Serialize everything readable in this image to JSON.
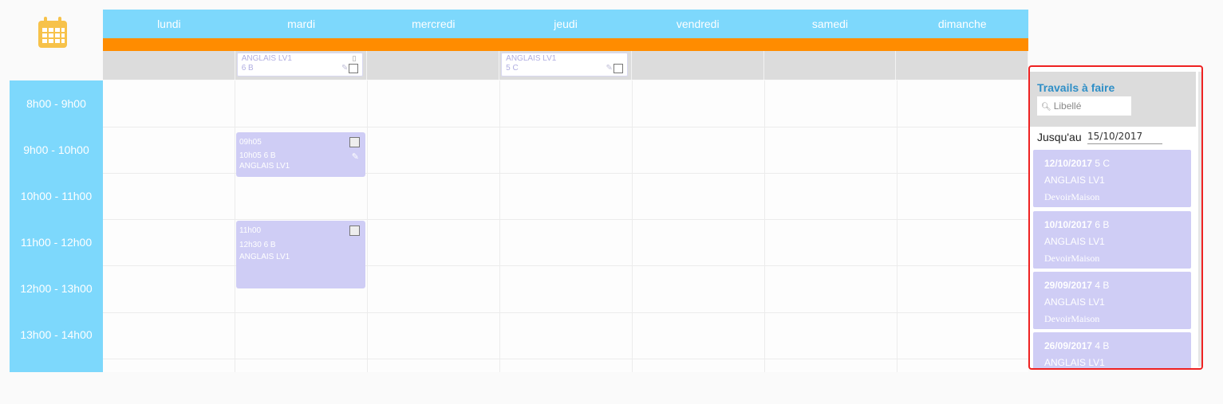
{
  "days": [
    "lundi",
    "mardi",
    "mercredi",
    "jeudi",
    "vendredi",
    "samedi",
    "dimanche"
  ],
  "allday": {
    "mardi_card": {
      "subject": "ANGLAIS LV1",
      "class": "6 B"
    },
    "jeudi_card": {
      "subject": "ANGLAIS LV1",
      "class": "5 C"
    }
  },
  "hours": [
    "8h00 - 9h00",
    "9h00 - 10h00",
    "10h00 - 11h00",
    "11h00 - 12h00",
    "12h00 - 13h00",
    "13h00 - 14h00",
    ""
  ],
  "events": [
    {
      "start": "09h05",
      "end_class": "10h05  6 B",
      "subject": "ANGLAIS LV1"
    },
    {
      "start": "11h00",
      "end_class": "12h30  6 B",
      "subject": "ANGLAIS LV1"
    }
  ],
  "panel": {
    "title": "Travails à faire",
    "search_placeholder": "Libellé",
    "until_label": "Jusqu'au",
    "until_date": "15/10/2017",
    "items": [
      {
        "date": "12/10/2017",
        "class": " 5 C",
        "subject": "ANGLAIS LV1",
        "kind": "DevoirMaison"
      },
      {
        "date": "10/10/2017",
        "class": " 6 B",
        "subject": "ANGLAIS LV1",
        "kind": "DevoirMaison"
      },
      {
        "date": "29/09/2017",
        "class": " 4 B",
        "subject": "ANGLAIS LV1",
        "kind": "DevoirMaison"
      },
      {
        "date": "26/09/2017",
        "class": " 4 B",
        "subject": "ANGLAIS LV1",
        "kind": ""
      }
    ]
  },
  "colors": {
    "header": "#7dd8fc",
    "accent": "#ff8c00",
    "event": "#cfcdf5",
    "highlight": "#e22222"
  }
}
